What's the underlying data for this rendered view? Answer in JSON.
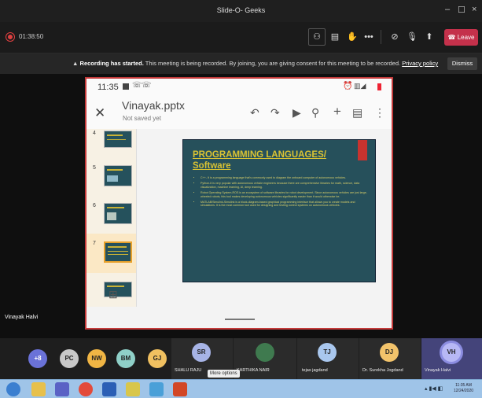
{
  "window": {
    "title": "Slide-O- Geeks"
  },
  "toolbar": {
    "timer": "01:38:50",
    "leave_label": "Leave"
  },
  "banner": {
    "heading": "Recording has started.",
    "message": "This meeting is being recorded. By joining, you are giving consent for this meeting to be recorded.",
    "link": "Privacy policy",
    "dismiss_label": "Dismiss"
  },
  "phone": {
    "time": "11:35",
    "file_name": "Vinayak.pptx",
    "save_status": "Not saved yet",
    "thumbnails": [
      {
        "num": "4"
      },
      {
        "num": "5"
      },
      {
        "num": "6"
      },
      {
        "num": "7"
      }
    ],
    "slide": {
      "title": "PROGRAMMING LANGUAGES/ Software",
      "bullets": [
        "C++- It is a programming language that's commonly used to diagram the onboard computer of autonomous vehicles.",
        "Python-It is very popular with autonomous vehicle engineers because there are comprehensive libraries for math, science, data visualization, machine learning, AI, deep learning.",
        "Robot Operating System-ROS is an ecosystem of software libraries for robot development. Since autonomous vehicles are just large, wheeled robots, this tool makes developing autonomous vehicles significantly easier than it would otherwise be.",
        "MATLAB/Simulink-Simulink is a block-diagram-based graphical programming interface that allows you to create models and simulations. It is the most common tool used for designing and testing control systems on autonomous vehicles."
      ]
    }
  },
  "speaker": {
    "name": "Vinayak Halvi"
  },
  "participants": {
    "overflow": "+8",
    "avatars": [
      {
        "initials": "PC",
        "color": "#c8c8c8"
      },
      {
        "initials": "NW",
        "color": "#f0b544"
      },
      {
        "initials": "BM",
        "color": "#8fd0c8"
      },
      {
        "initials": "GJ",
        "color": "#f0c060"
      }
    ],
    "tiles": [
      {
        "initials": "SR",
        "name": "SHALU RAJU",
        "color": "#a7b4e6"
      },
      {
        "initials": "",
        "name": "KARTHIKA NAIR",
        "color": "#3f7a4f"
      },
      {
        "initials": "TJ",
        "name": "tejas jagdand",
        "color": "#a9c7ee"
      },
      {
        "initials": "DJ",
        "name": "Dr. Surekha Jogdand",
        "color": "#f2c36b"
      },
      {
        "initials": "VH",
        "name": "Vinayak Halvi",
        "color": "#b7b8f5"
      }
    ],
    "tooltip": "More options"
  },
  "taskbar": {
    "time": "11:35 AM",
    "date": "12/24/2020",
    "apps": [
      {
        "name": "start-orb",
        "color": "#3b7fd0"
      },
      {
        "name": "explorer",
        "color": "#e7c04c"
      },
      {
        "name": "teams",
        "color": "#5a62c5"
      },
      {
        "name": "chrome",
        "color": "#e34a3a"
      },
      {
        "name": "word",
        "color": "#2b5fb5"
      },
      {
        "name": "security",
        "color": "#d8c64b"
      },
      {
        "name": "notes",
        "color": "#4aa0d8"
      },
      {
        "name": "powerpoint",
        "color": "#d24726"
      }
    ]
  }
}
